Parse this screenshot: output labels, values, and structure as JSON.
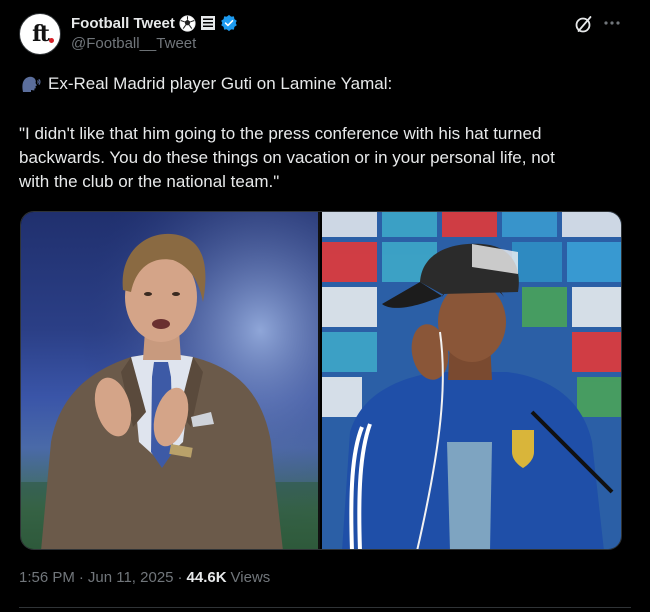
{
  "author": {
    "display_name": "Football Tweet",
    "handle": "@Football__Tweet",
    "avatar_text": "ft"
  },
  "tweet": {
    "intro": "Ex-Real Madrid player Guti on Lamine Yamal:",
    "quote_lines": [
      "\"I didn't like that him going to the press conference with his hat turned",
      "backwards. You do these things on vacation or in your personal life, not",
      "with the club or the national team.\""
    ]
  },
  "meta": {
    "time": "1:56 PM",
    "separator": "·",
    "date": "Jun 11, 2025",
    "views_count": "44.6K",
    "views_label": "Views"
  },
  "colors": {
    "background": "#000000",
    "text": "#e7e9ea",
    "muted": "#71767b",
    "verified": "#1d9bf0"
  },
  "icons": [
    "speaking-head-icon",
    "soccer-ball-icon",
    "list-icon",
    "verified-badge-icon",
    "grok-icon",
    "more-icon"
  ]
}
